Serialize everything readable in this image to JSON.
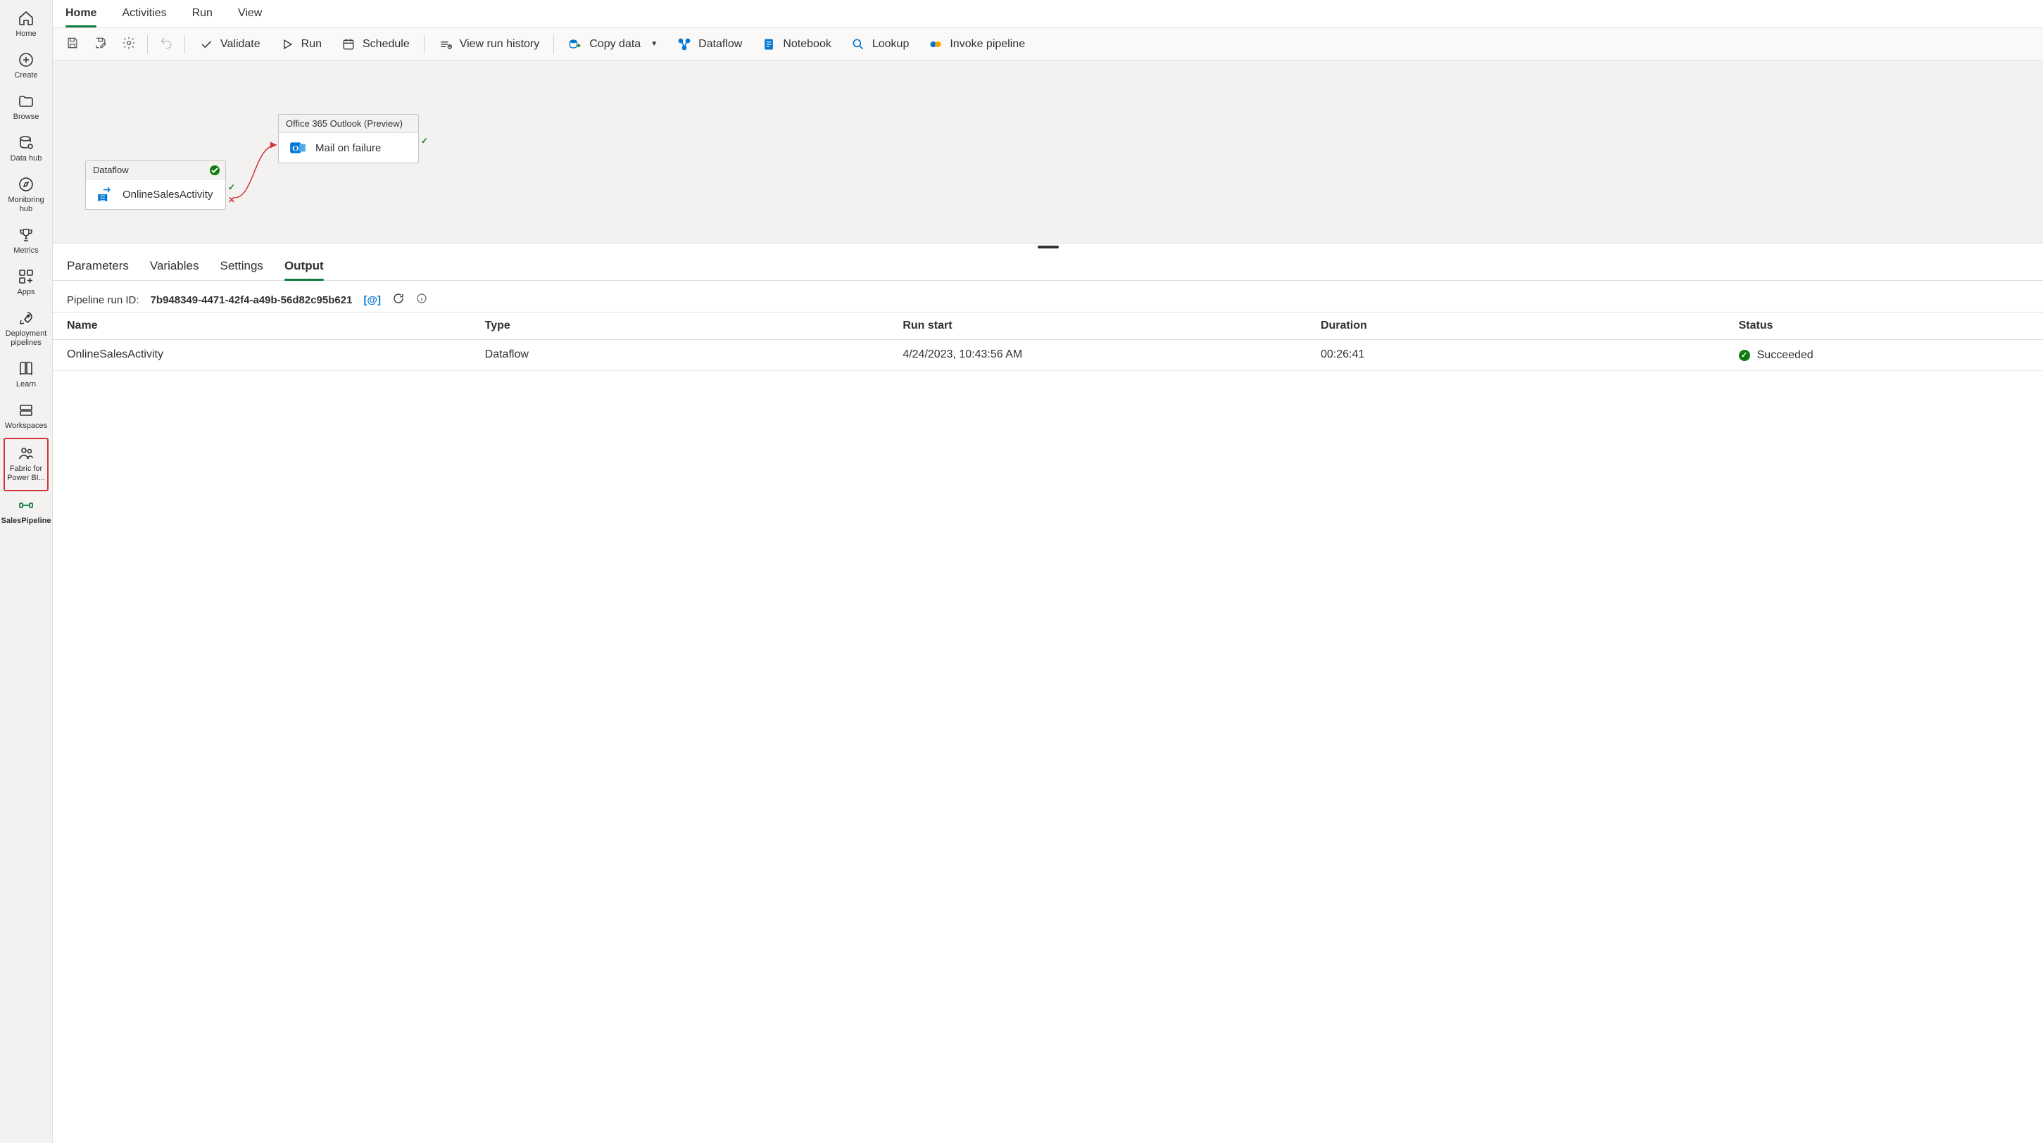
{
  "sidebar": {
    "items": [
      {
        "label": "Home"
      },
      {
        "label": "Create"
      },
      {
        "label": "Browse"
      },
      {
        "label": "Data hub"
      },
      {
        "label": "Monitoring hub"
      },
      {
        "label": "Metrics"
      },
      {
        "label": "Apps"
      },
      {
        "label": "Deployment pipelines"
      },
      {
        "label": "Learn"
      },
      {
        "label": "Workspaces"
      },
      {
        "label": "Fabric for Power BI..."
      },
      {
        "label": "SalesPipeline"
      }
    ]
  },
  "menu_tabs": [
    "Home",
    "Activities",
    "Run",
    "View"
  ],
  "ribbon": {
    "validate": "Validate",
    "run": "Run",
    "schedule": "Schedule",
    "view_history": "View run history",
    "copy_data": "Copy data",
    "dataflow": "Dataflow",
    "notebook": "Notebook",
    "lookup": "Lookup",
    "invoke": "Invoke pipeline"
  },
  "canvas": {
    "node1": {
      "header": "Dataflow",
      "body": "OnlineSalesActivity"
    },
    "node2": {
      "header": "Office 365 Outlook (Preview)",
      "body": "Mail on failure"
    }
  },
  "detail_tabs": [
    "Parameters",
    "Variables",
    "Settings",
    "Output"
  ],
  "run": {
    "label": "Pipeline run ID:",
    "id": "7b948349-4471-42f4-a49b-56d82c95b621"
  },
  "table": {
    "headers": [
      "Name",
      "Type",
      "Run start",
      "Duration",
      "Status"
    ],
    "row": {
      "name": "OnlineSalesActivity",
      "type": "Dataflow",
      "start": "4/24/2023, 10:43:56 AM",
      "duration": "00:26:41",
      "status": "Succeeded"
    }
  }
}
